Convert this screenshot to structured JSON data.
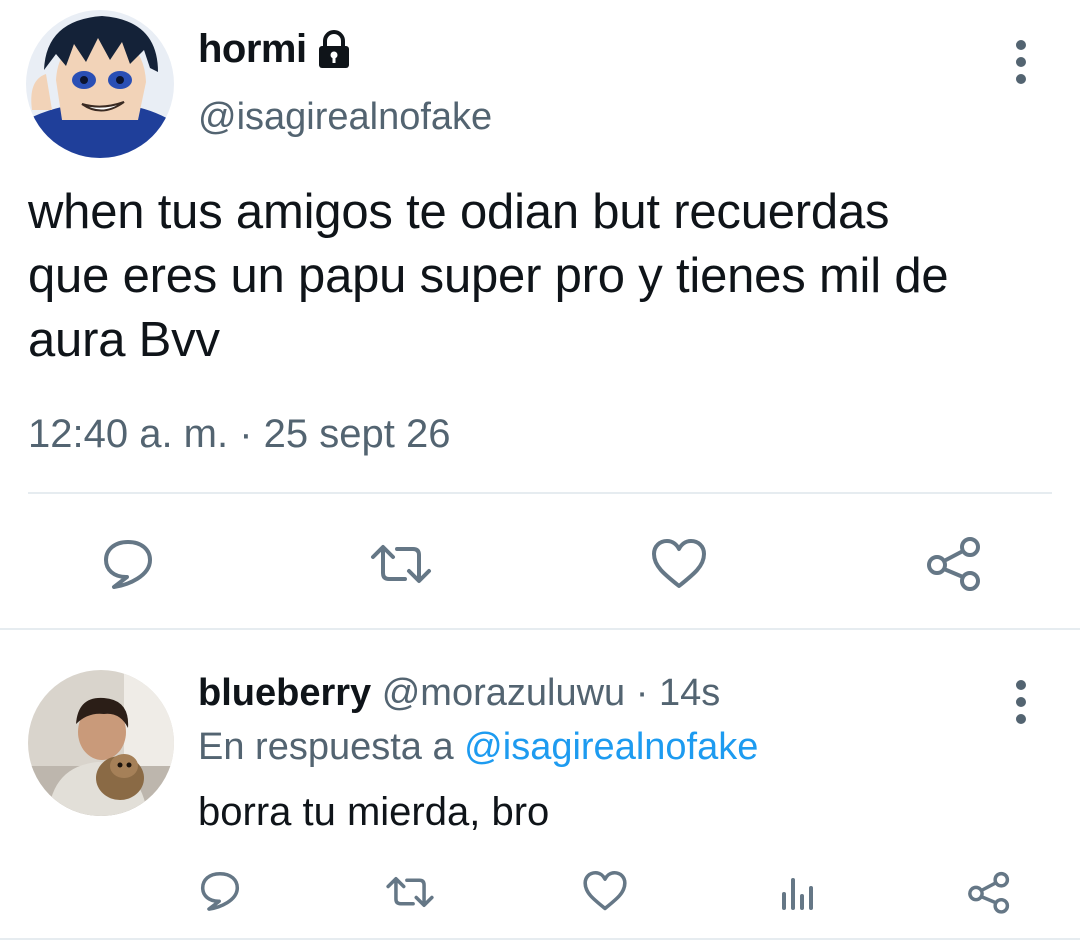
{
  "tweet": {
    "display_name": "hormi",
    "handle": "@isagirealnofake",
    "text_lines": [
      "when tus amigos te odian but recuerdas",
      "que eres un papu super pro y tienes mil de",
      "aura Bvv"
    ],
    "timestamp": "12:40 a. m. · 25 sept 26",
    "icons": [
      "lock-icon",
      "more-icon",
      "reply-icon",
      "retweet-icon",
      "like-icon",
      "share-icon"
    ]
  },
  "reply": {
    "display_name": "blueberry",
    "handle": "@morazuluwu",
    "separator": "·",
    "time": "14s",
    "context_prefix": "En respuesta a ",
    "context_mention": "@isagirealnofake",
    "text": "borra tu mierda, bro",
    "icons": [
      "reply-icon",
      "retweet-icon",
      "like-icon",
      "analytics-icon",
      "share-icon",
      "more-icon"
    ]
  },
  "colors": {
    "text": "#0f1419",
    "secondary": "#536471",
    "icon": "#657786",
    "mention": "#1d9bf0",
    "divider": "#e6ecf0"
  }
}
